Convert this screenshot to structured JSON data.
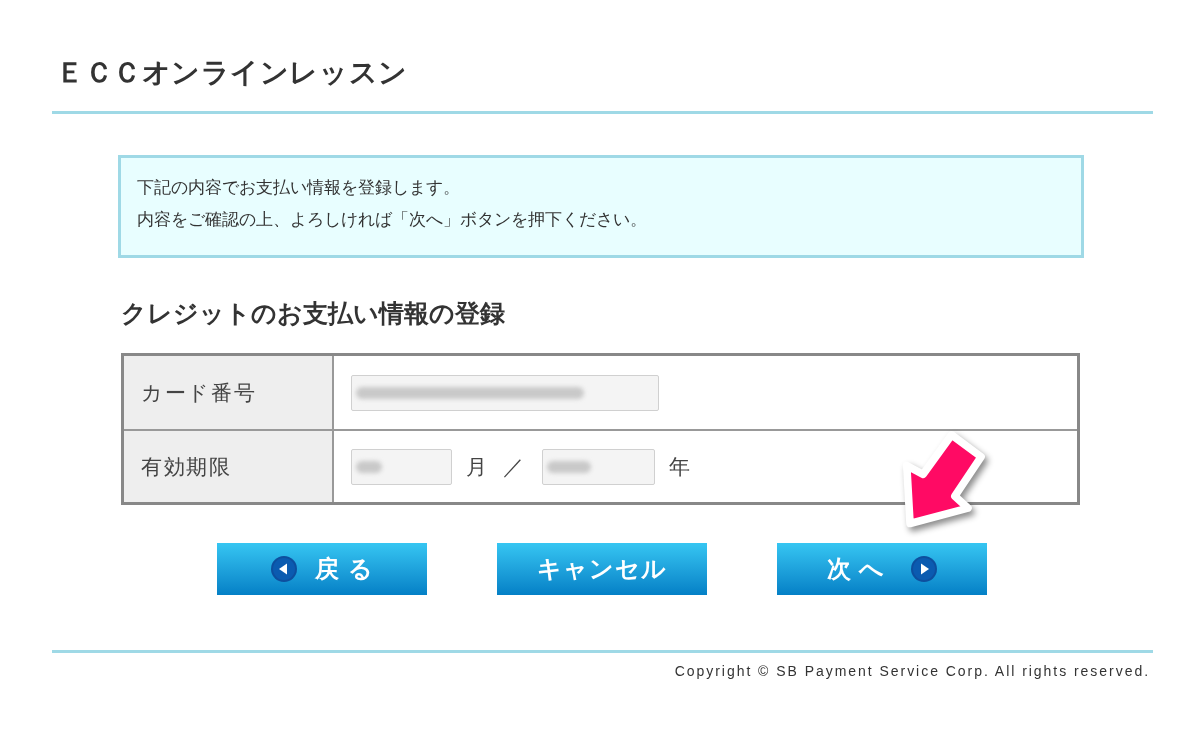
{
  "site_title": "ＥＣＣオンラインレッスン",
  "notice": {
    "lines": [
      "下記の内容でお支払い情報を登録します。",
      "内容をご確認の上、よろしければ「次へ」ボタンを押下ください。"
    ]
  },
  "section_title": "クレジットのお支払い情報の登録",
  "form_rows": [
    {
      "label": "カード番号",
      "items": [
        {
          "kind": "card_number_field",
          "blurred": true
        }
      ]
    },
    {
      "label": "有効期限",
      "items": [
        {
          "kind": "month_field",
          "blurred": true
        },
        {
          "kind": "text",
          "text": "月"
        },
        {
          "kind": "text",
          "text": "／"
        },
        {
          "kind": "year_field",
          "blurred": true
        },
        {
          "kind": "text",
          "text": "年"
        }
      ]
    }
  ],
  "buttons": [
    {
      "label": "戻る",
      "kind": "back"
    },
    {
      "label": "キャンセル",
      "kind": "cancel"
    },
    {
      "label": "次へ",
      "kind": "next"
    }
  ],
  "footer": {
    "copyright": "Copyright © SB Payment Service Corp. All rights reserved."
  }
}
